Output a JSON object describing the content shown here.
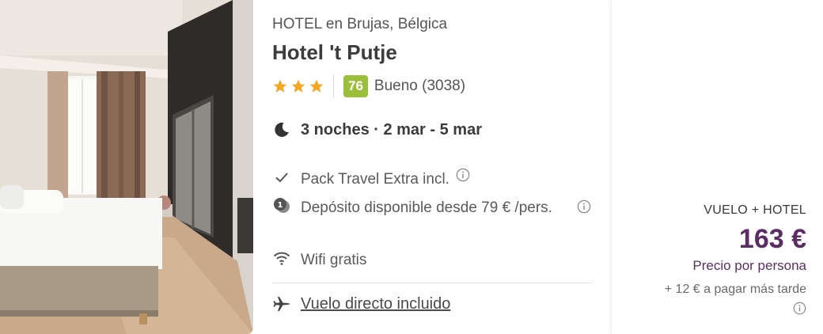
{
  "hotel": {
    "category": "HOTEL en Brujas, Bélgica",
    "name": "Hotel 't Putje",
    "stars": 3,
    "score": "76",
    "review": "Bueno (3038)"
  },
  "stay": {
    "text": "3 noches · 2 mar - 5 mar",
    "icon": "moon-icon"
  },
  "features": [
    {
      "icon": "check-icon",
      "text": "Pack Travel Extra incl.",
      "has_info": true
    },
    {
      "icon": "deposit-icon",
      "text": "Depósito disponible desde 79 € /pers.",
      "has_info": true
    },
    {
      "icon": "wifi-icon",
      "text": "Wifi gratis",
      "has_info": false
    }
  ],
  "flight": {
    "icon": "plane-icon",
    "text": "Vuelo directo incluido"
  },
  "price": {
    "package": "VUELO + HOTEL",
    "amount": "163 €",
    "per_person": "Precio por persona",
    "extra": "+ 12 € a pagar más tarde"
  },
  "colors": {
    "price": "#5b2d64",
    "star": "#f5a623",
    "score_badge": "#9cbf3b"
  }
}
